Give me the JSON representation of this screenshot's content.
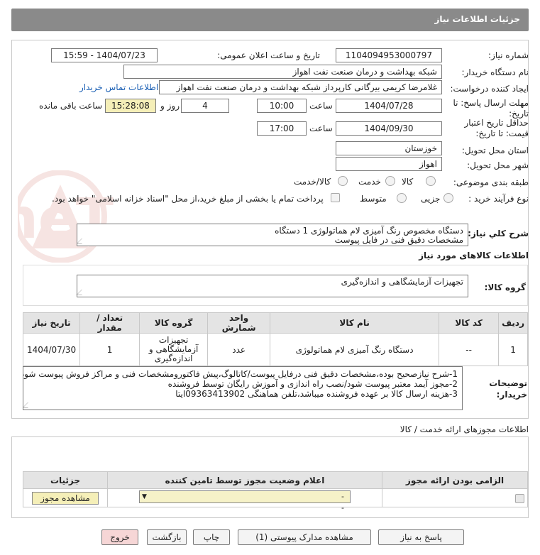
{
  "header": {
    "title": "جزئیات اطلاعات نیاز"
  },
  "fields": {
    "need_number_label": "شماره نیاز:",
    "need_number": "1104094953000797",
    "announce_label": "تاریخ و ساعت اعلان عمومی:",
    "announce_value": "1404/07/23 - 15:59",
    "buyer_org_label": "نام دستگاه خریدار:",
    "buyer_org": "شبکه بهداشت و درمان صنعت نفت اهواز",
    "creator_label": "ایجاد کننده درخواست:",
    "creator": "غلامرضا کریمی بیرگانی کارپرداز شبکه بهداشت و درمان صنعت نفت اهواز",
    "contact_link": "اطلاعات تماس خریدار",
    "deadline_label": "مهلت ارسال پاسخ: تا تاریخ:",
    "deadline_date": "1404/07/28",
    "time_label": "ساعت",
    "deadline_time": "10:00",
    "days_value": "4",
    "days_label": "روز و",
    "remaining_time": "15:28:08",
    "remaining_label": "ساعت باقی مانده",
    "validity_label": "حداقل تاریخ اعتبار قیمت: تا تاریخ:",
    "validity_date": "1404/09/30",
    "validity_time": "17:00",
    "province_label": "استان محل تحویل:",
    "province": "خوزستان",
    "city_label": "شهر محل تحویل:",
    "city": "اهواز",
    "category_label": "طبقه بندی موضوعی:",
    "category_options": [
      "کالا",
      "خدمت",
      "کالا/خدمت"
    ],
    "process_label": "نوع فرآیند خرید :",
    "process_options": [
      "جزیی",
      "متوسط"
    ],
    "payment_note": "پرداخت تمام یا بخشی از مبلغ خرید،از محل \"اسناد خزانه اسلامی\" خواهد بود."
  },
  "summary": {
    "label": "شرح کلي نیاز:",
    "line1": "دستگاه مخصوص رنگ آمیزی لام هماتولوژی    1 دستگاه",
    "line2": "مشخصات دقیق فنی در فایل پیوست"
  },
  "goods_section_title": "اطلاعات کالاهای مورد نیاز",
  "goods_group": {
    "label": "گروه کالا:",
    "value": "تجهیزات آزمایشگاهی و اندازه‌گیری"
  },
  "goods_table": {
    "headers": [
      "ردیف",
      "کد کالا",
      "نام کالا",
      "واحد شمارش",
      "گروه کالا",
      "تعداد / مقدار",
      "تاریخ نیاز"
    ],
    "rows": [
      [
        "1",
        "--",
        "دستگاه رنگ آمیزی لام هماتولوژی",
        "عدد",
        "تجهیزات آزمایشگاهی و اندازه‌گیری",
        "1",
        "1404/07/30"
      ]
    ]
  },
  "buyer_notes": {
    "label": "توضیحات خریدار:",
    "line1": "1-شرح نیازصحیح بوده،مشخصات دقیق فنی درفایل پیوست/کاتالوگ،پیش فاکتورومشخصات فنی و مراکز فروش پیوست شود",
    "line2": "2-مجوز آیمد معتبر پیوست شود/نصب راه اندازی و آموزش رایگان توسط فروشنده",
    "line3": "3-هزینه ارسال کالا بر عهده فروشنده میباشد،تلفن هماهنگی 09363413902ایتا"
  },
  "license_section": {
    "title": "اطلاعات مجوزهای ارائه خدمت / کالا",
    "headers": [
      "الزامی بودن ارائه مجوز",
      "اعلام وضعیت مجوز توسط تامین کننده",
      "جزئیات"
    ],
    "select_value": "--",
    "view_button": "مشاهده مجوز"
  },
  "buttons": {
    "reply": "پاسخ به نیاز",
    "attachments": "مشاهده مدارک پیوستی (1)",
    "print": "چاپ",
    "back": "بازگشت",
    "exit": "خروج"
  },
  "watermark_text": "AriaTender.neT",
  "colors": {
    "header": "#8a8a8a",
    "exit_button": "#f6d6d6",
    "highlight": "#f5efb8",
    "link": "#1a5fb4"
  }
}
